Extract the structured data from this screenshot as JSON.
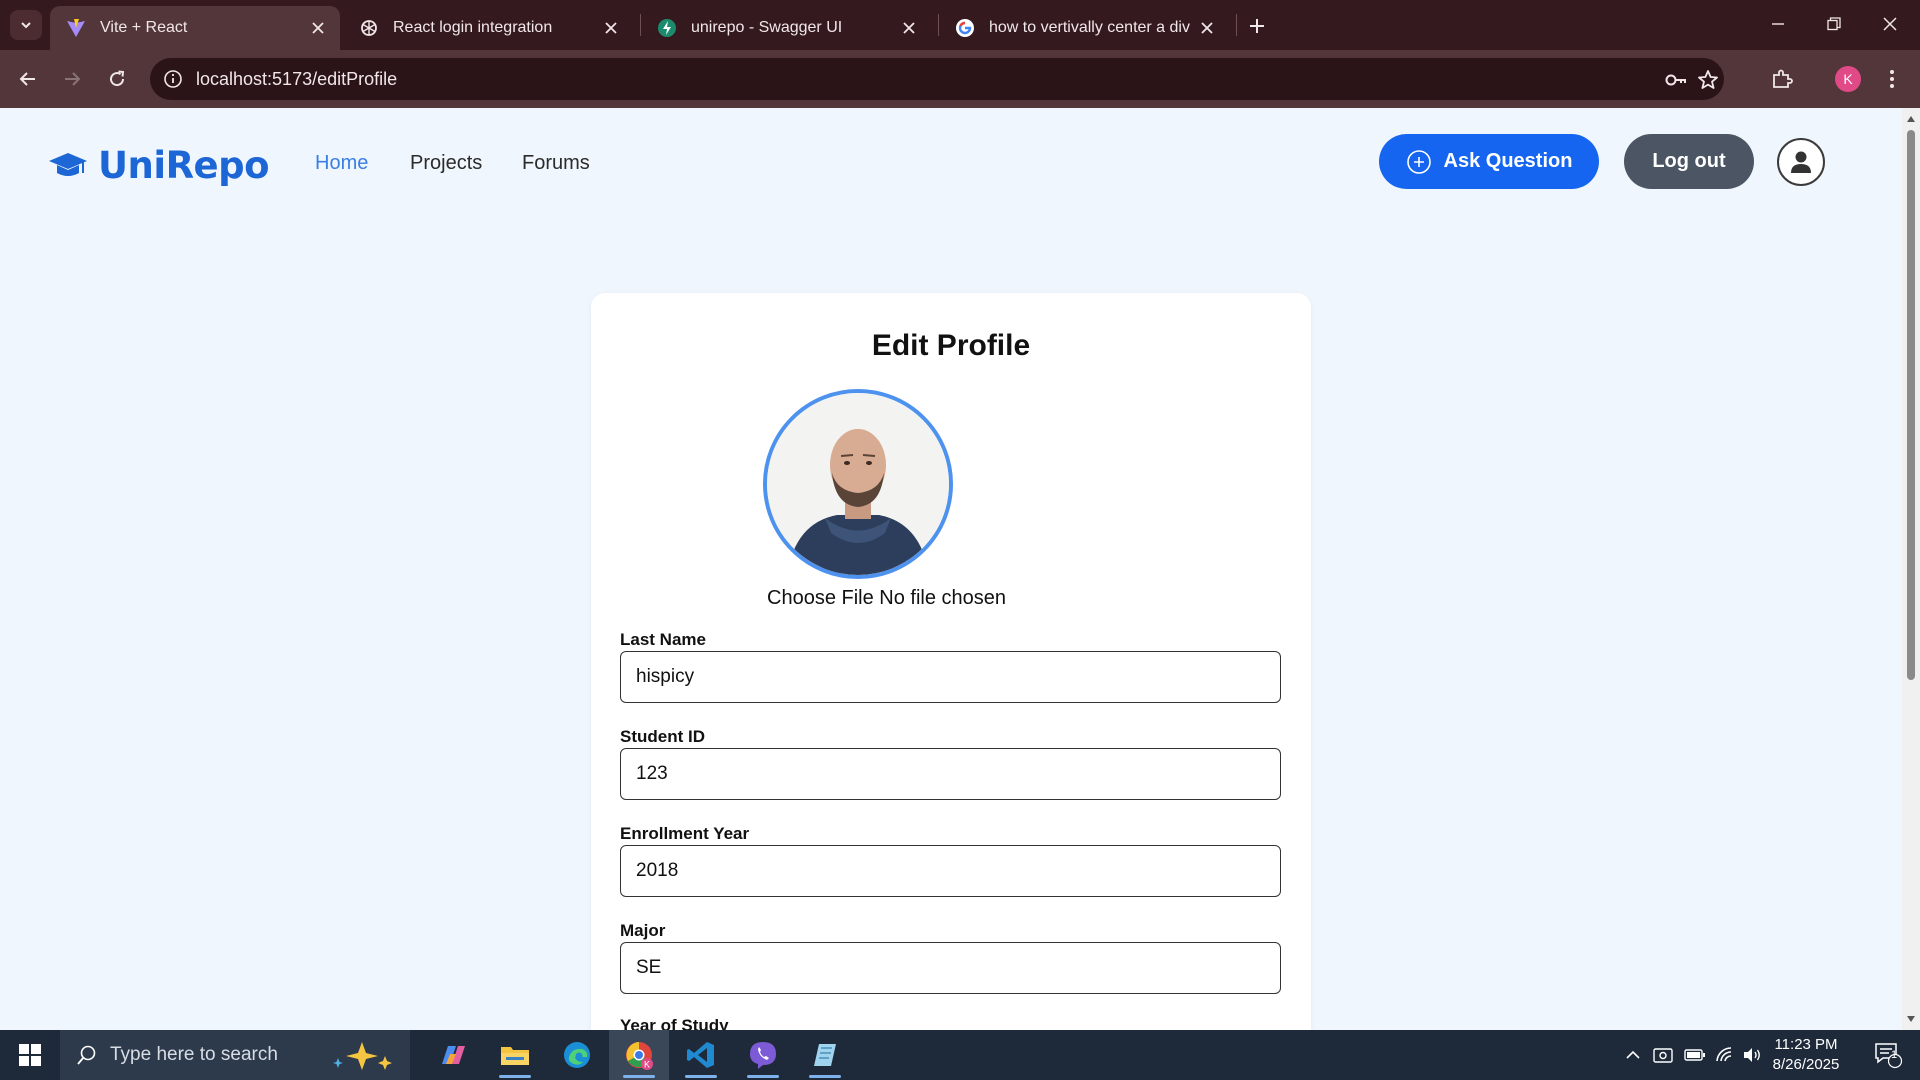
{
  "browser": {
    "tabs": [
      {
        "title": "Vite + React",
        "icon": "vite-icon",
        "active": true
      },
      {
        "title": "React login integration",
        "icon": "openai-icon",
        "active": false
      },
      {
        "title": "unirepo - Swagger UI",
        "icon": "swagger-icon",
        "active": false
      },
      {
        "title": "how to vertivally center a div - C",
        "icon": "google-icon",
        "active": false
      }
    ],
    "url": "localhost:5173/editProfile",
    "profile_initial": "K"
  },
  "site": {
    "logo_text": "UniRepo",
    "logo_icon": "graduation-cap-icon",
    "nav": [
      {
        "label": "Home",
        "active": true
      },
      {
        "label": "Projects",
        "active": false
      },
      {
        "label": "Forums",
        "active": false
      }
    ],
    "ask_label": "Ask Question",
    "logout_label": "Log out",
    "accent_color": "#1565f0"
  },
  "form": {
    "title": "Edit Profile",
    "file_label": "Choose File",
    "file_status": "No file chosen",
    "fields": [
      {
        "label": "Last Name",
        "value": "hispicy"
      },
      {
        "label": "Student ID",
        "value": "123"
      },
      {
        "label": "Enrollment Year",
        "value": "2018"
      },
      {
        "label": "Major",
        "value": "SE"
      }
    ],
    "partial_label": "Year of Study"
  },
  "taskbar": {
    "search_placeholder": "Type here to search",
    "time": "11:23 PM",
    "date": "8/26/2025",
    "notification_count": "1"
  }
}
